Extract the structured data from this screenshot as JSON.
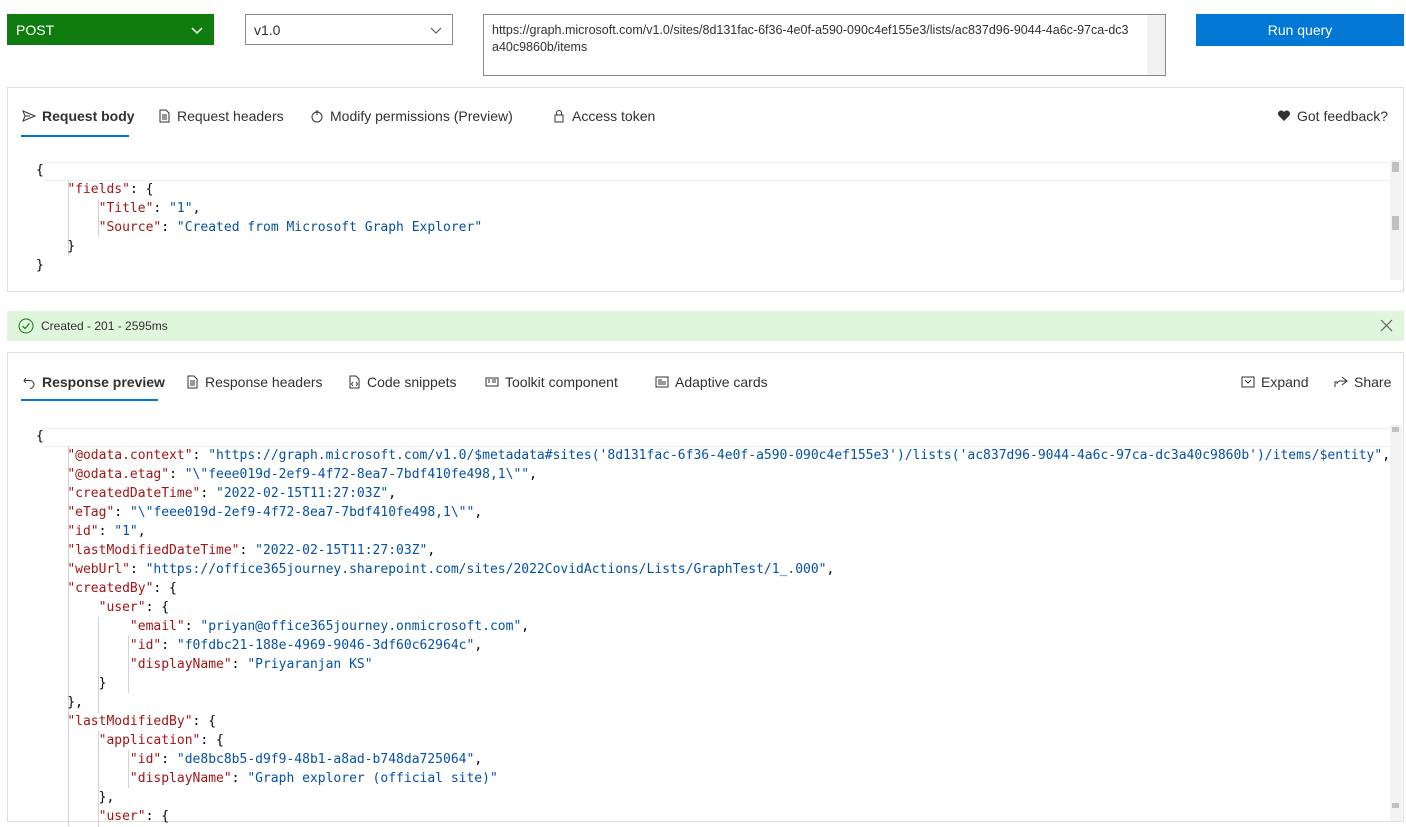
{
  "query": {
    "method": "POST",
    "version": "v1.0",
    "url": "https://graph.microsoft.com/v1.0/sites/8d131fac-6f36-4e0f-a590-090c4ef155e3/lists/ac837d96-9044-4a6c-97ca-dc3a40c9860b/items",
    "run_label": "Run query",
    "method_color": "#107c10",
    "run_color": "#0078d4"
  },
  "request": {
    "tabs": [
      {
        "label": "Request body",
        "icon": "send-icon"
      },
      {
        "label": "Request headers",
        "icon": "document-icon"
      },
      {
        "label": "Modify permissions (Preview)",
        "icon": "permissions-icon"
      },
      {
        "label": "Access token",
        "icon": "lock-icon"
      }
    ],
    "feedback": {
      "label": "Got feedback?",
      "icon": "heart-icon"
    },
    "body_lines": [
      [
        [
          "p",
          "{"
        ]
      ],
      [
        [
          "p",
          "    "
        ],
        [
          "k",
          "\"fields\""
        ],
        [
          "p",
          ": {"
        ]
      ],
      [
        [
          "p",
          "        "
        ],
        [
          "k",
          "\"Title\""
        ],
        [
          "p",
          ": "
        ],
        [
          "s",
          "\"1\""
        ],
        [
          "p",
          ","
        ]
      ],
      [
        [
          "p",
          "        "
        ],
        [
          "k",
          "\"Source\""
        ],
        [
          "p",
          ": "
        ],
        [
          "s",
          "\"Created from Microsoft Graph Explorer\""
        ]
      ],
      [
        [
          "p",
          "    }"
        ]
      ],
      [
        [
          "p",
          "}"
        ]
      ]
    ]
  },
  "status": {
    "text": "Created - 201 - 2595ms",
    "icon": "checkmark-circle-icon",
    "color": "#dff6dd"
  },
  "response": {
    "tabs": [
      {
        "label": "Response preview",
        "icon": "undo-icon"
      },
      {
        "label": "Response headers",
        "icon": "document-icon"
      },
      {
        "label": "Code snippets",
        "icon": "code-icon"
      },
      {
        "label": "Toolkit component",
        "icon": "toolkit-icon"
      },
      {
        "label": "Adaptive cards",
        "icon": "card-icon"
      }
    ],
    "actions": [
      {
        "label": "Expand",
        "icon": "expand-icon"
      },
      {
        "label": "Share",
        "icon": "share-icon"
      }
    ],
    "body_lines": [
      [
        [
          "p",
          "{"
        ]
      ],
      [
        [
          "p",
          "    "
        ],
        [
          "k",
          "\"@odata.context\""
        ],
        [
          "p",
          ": "
        ],
        [
          "s",
          "\"https://graph.microsoft.com/v1.0/$metadata#sites('8d131fac-6f36-4e0f-a590-090c4ef155e3')/lists('ac837d96-9044-4a6c-97ca-dc3a40c9860b')/items/$entity\""
        ],
        [
          "p",
          ","
        ]
      ],
      [
        [
          "p",
          "    "
        ],
        [
          "k",
          "\"@odata.etag\""
        ],
        [
          "p",
          ": "
        ],
        [
          "s",
          "\"\\\"feee019d-2ef9-4f72-8ea7-7bdf410fe498,1\\\"\""
        ],
        [
          "p",
          ","
        ]
      ],
      [
        [
          "p",
          "    "
        ],
        [
          "k",
          "\"createdDateTime\""
        ],
        [
          "p",
          ": "
        ],
        [
          "s",
          "\"2022-02-15T11:27:03Z\""
        ],
        [
          "p",
          ","
        ]
      ],
      [
        [
          "p",
          "    "
        ],
        [
          "k",
          "\"eTag\""
        ],
        [
          "p",
          ": "
        ],
        [
          "s",
          "\"\\\"feee019d-2ef9-4f72-8ea7-7bdf410fe498,1\\\"\""
        ],
        [
          "p",
          ","
        ]
      ],
      [
        [
          "p",
          "    "
        ],
        [
          "k",
          "\"id\""
        ],
        [
          "p",
          ": "
        ],
        [
          "s",
          "\"1\""
        ],
        [
          "p",
          ","
        ]
      ],
      [
        [
          "p",
          "    "
        ],
        [
          "k",
          "\"lastModifiedDateTime\""
        ],
        [
          "p",
          ": "
        ],
        [
          "s",
          "\"2022-02-15T11:27:03Z\""
        ],
        [
          "p",
          ","
        ]
      ],
      [
        [
          "p",
          "    "
        ],
        [
          "k",
          "\"webUrl\""
        ],
        [
          "p",
          ": "
        ],
        [
          "s",
          "\"https://office365journey.sharepoint.com/sites/2022CovidActions/Lists/GraphTest/1_.000\""
        ],
        [
          "p",
          ","
        ]
      ],
      [
        [
          "p",
          "    "
        ],
        [
          "k",
          "\"createdBy\""
        ],
        [
          "p",
          ": {"
        ]
      ],
      [
        [
          "p",
          "        "
        ],
        [
          "k",
          "\"user\""
        ],
        [
          "p",
          ": {"
        ]
      ],
      [
        [
          "p",
          "            "
        ],
        [
          "k",
          "\"email\""
        ],
        [
          "p",
          ": "
        ],
        [
          "s",
          "\"priyan@office365journey.onmicrosoft.com\""
        ],
        [
          "p",
          ","
        ]
      ],
      [
        [
          "p",
          "            "
        ],
        [
          "k",
          "\"id\""
        ],
        [
          "p",
          ": "
        ],
        [
          "s",
          "\"f0fdbc21-188e-4969-9046-3df60c62964c\""
        ],
        [
          "p",
          ","
        ]
      ],
      [
        [
          "p",
          "            "
        ],
        [
          "k",
          "\"displayName\""
        ],
        [
          "p",
          ": "
        ],
        [
          "s",
          "\"Priyaranjan KS\""
        ]
      ],
      [
        [
          "p",
          "        }"
        ]
      ],
      [
        [
          "p",
          "    },"
        ]
      ],
      [
        [
          "p",
          "    "
        ],
        [
          "k",
          "\"lastModifiedBy\""
        ],
        [
          "p",
          ": {"
        ]
      ],
      [
        [
          "p",
          "        "
        ],
        [
          "k",
          "\"application\""
        ],
        [
          "p",
          ": {"
        ]
      ],
      [
        [
          "p",
          "            "
        ],
        [
          "k",
          "\"id\""
        ],
        [
          "p",
          ": "
        ],
        [
          "s",
          "\"de8bc8b5-d9f9-48b1-a8ad-b748da725064\""
        ],
        [
          "p",
          ","
        ]
      ],
      [
        [
          "p",
          "            "
        ],
        [
          "k",
          "\"displayName\""
        ],
        [
          "p",
          ": "
        ],
        [
          "s",
          "\"Graph explorer (official site)\""
        ]
      ],
      [
        [
          "p",
          "        },"
        ]
      ],
      [
        [
          "p",
          "        "
        ],
        [
          "k",
          "\"user\""
        ],
        [
          "p",
          ": {"
        ]
      ]
    ]
  }
}
